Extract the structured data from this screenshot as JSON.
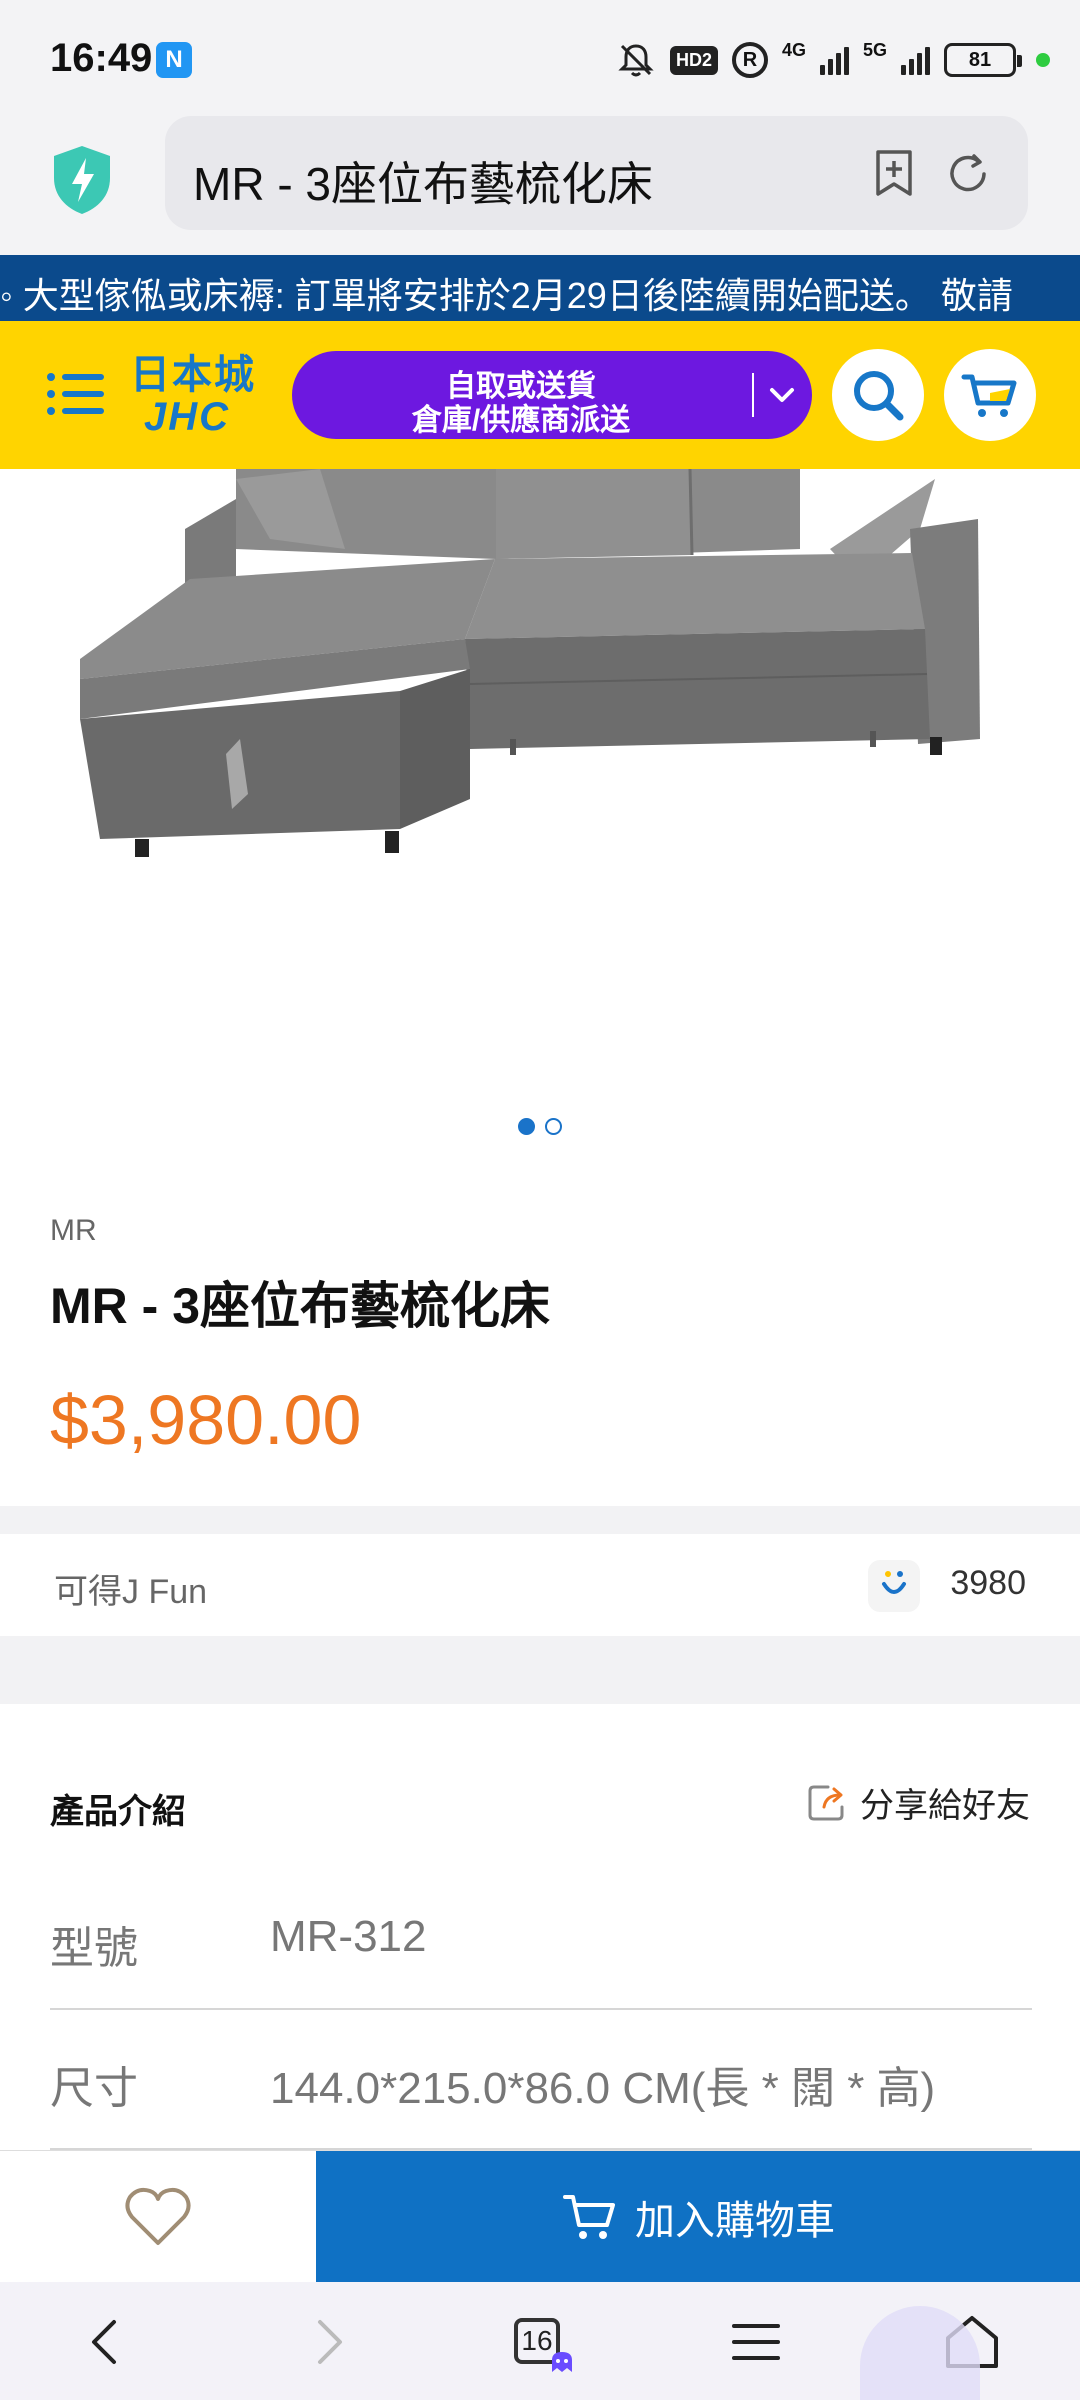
{
  "status": {
    "time": "16:49",
    "nfc": "N",
    "hd": "HD2",
    "registered": "R",
    "net1": "4G",
    "net2": "5G",
    "battery": "81"
  },
  "browser": {
    "url_title": "MR - 3座位布藝梳化床"
  },
  "banner": {
    "text": "◦ 大型傢俬或床褥: 訂單將安排於2月29日後陸續開始配送。 敬請"
  },
  "header": {
    "logo_top": "日本城",
    "logo_bottom": "JHC",
    "delivery_line1": "自取或送貨",
    "delivery_line2": "倉庫/供應商派送"
  },
  "product": {
    "brand": "MR",
    "title": "MR - 3座位布藝梳化床",
    "price": "$3,980.00",
    "image_count": 2,
    "active_image": 1
  },
  "jfun": {
    "label": "可得J Fun",
    "value": "3980"
  },
  "intro": {
    "title": "產品介紹",
    "share_label": "分享給好友",
    "specs": [
      {
        "label": "型號",
        "value": "MR-312"
      },
      {
        "label": "尺寸",
        "value": "144.0*215.0*86.0 CM(長 * 闊 * 高)"
      }
    ]
  },
  "actions": {
    "add_to_cart": "加入購物車"
  },
  "nav": {
    "tab_count": "16"
  },
  "colors": {
    "banner": "#0b4a8c",
    "header": "#ffd400",
    "delivery_button": "#6d18e0",
    "price": "#ee7722",
    "cart_button": "#0f71c4"
  }
}
